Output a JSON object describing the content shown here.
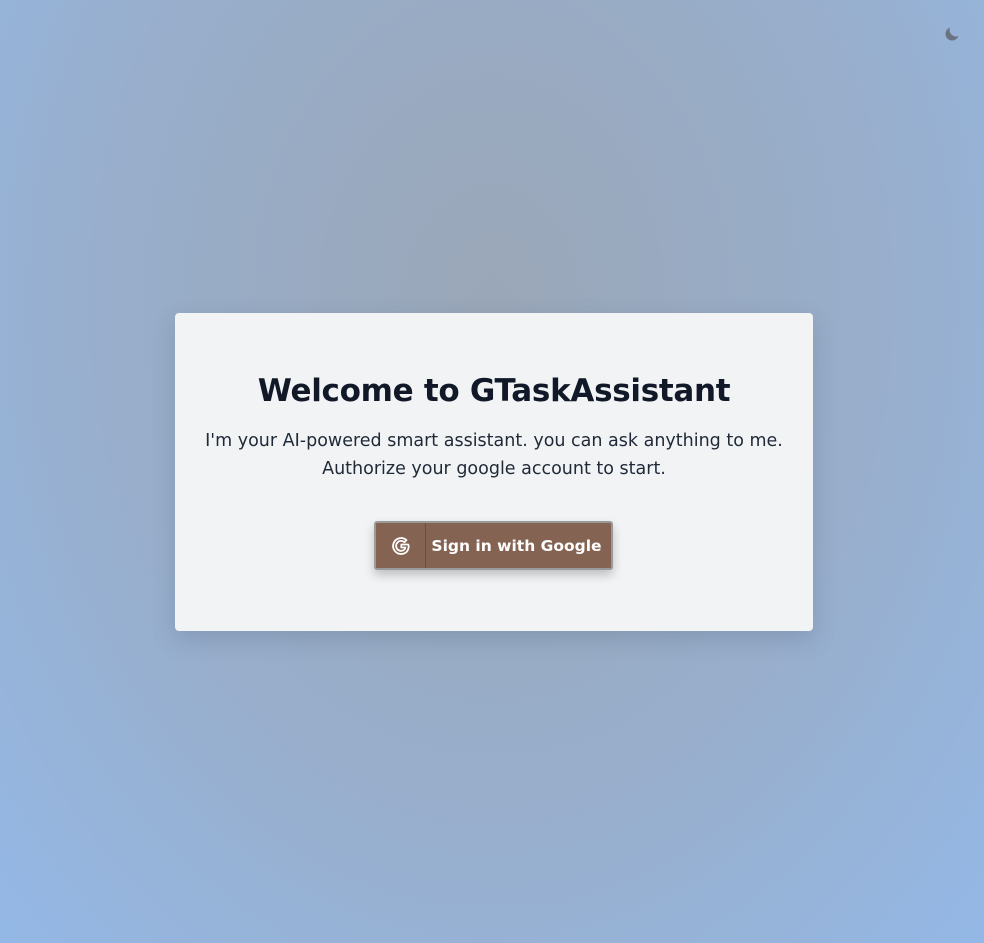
{
  "header": {
    "theme_toggle_icon": "moon-icon"
  },
  "welcome_card": {
    "title": "Welcome to GTaskAssistant",
    "description_line1": "I'm your AI-powered smart assistant. you can ask anything to me.",
    "description_line2": "Authorize your google account to start.",
    "signin_button": {
      "label": "Sign in with Google",
      "icon": "google-icon",
      "background": "#856353"
    }
  }
}
